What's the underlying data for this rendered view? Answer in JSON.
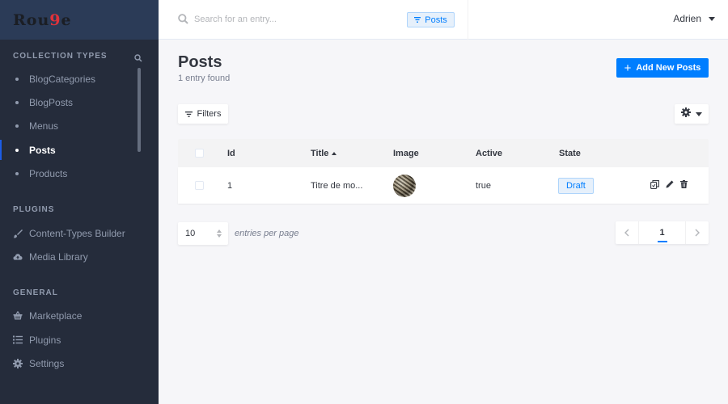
{
  "brand": {
    "prefix": "Rou",
    "accent": "9",
    "suffix": "e"
  },
  "sidebar": {
    "collection_types_title": "Collection Types",
    "collection_items": [
      {
        "label": "BlogCategories"
      },
      {
        "label": "BlogPosts"
      },
      {
        "label": "Menus"
      },
      {
        "label": "Posts",
        "active": true
      },
      {
        "label": "Products"
      }
    ],
    "plugins_title": "Plugins",
    "plugin_items": [
      {
        "label": "Content-Types Builder",
        "icon": "paintbrush-icon"
      },
      {
        "label": "Media Library",
        "icon": "cloud-upload-icon"
      }
    ],
    "general_title": "General",
    "general_items": [
      {
        "label": "Marketplace",
        "icon": "shopping-basket-icon"
      },
      {
        "label": "Plugins",
        "icon": "list-icon"
      },
      {
        "label": "Settings",
        "icon": "gear-icon"
      }
    ]
  },
  "header": {
    "search_placeholder": "Search for an entry...",
    "search_tag": "Posts",
    "user_name": "Adrien"
  },
  "main": {
    "title": "Posts",
    "entry_count": "1 entry found",
    "add_button": "Add New Posts",
    "filters_button": "Filters"
  },
  "table": {
    "columns": [
      "Id",
      "Title",
      "Image",
      "Active",
      "State"
    ],
    "sorted_column": "Title",
    "sort_direction": "ascending",
    "rows": [
      {
        "id": "1",
        "title": "Titre de mo...",
        "active": "true",
        "state": "Draft"
      }
    ]
  },
  "pagination": {
    "per_page": "10",
    "per_page_label": "entries per page",
    "current_page": "1"
  },
  "colors": {
    "primary": "#007eff",
    "sidebar_bg": "#252c3b",
    "brand_bg": "#2b3b57",
    "active_indicator": "#1c5de7",
    "badge_bg": "#e6f0fb"
  }
}
